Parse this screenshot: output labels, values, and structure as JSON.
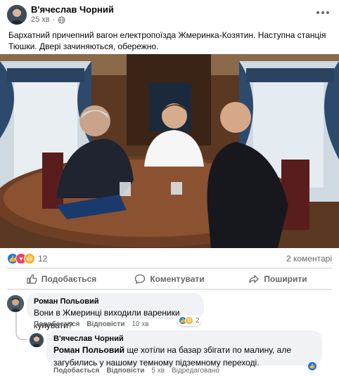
{
  "post": {
    "author": "В'ячеслав Чорний",
    "time": "25 хв",
    "text": "Бархатний причепний вагон електропоїзда Жмеринка-Козятин. Наступна станція Тюшки. Двері зачиняються, обережно."
  },
  "reactions": {
    "icons": [
      "like",
      "love",
      "haha"
    ],
    "count": "12",
    "comments_label": "2 коментарі"
  },
  "actions": {
    "like_label": "Подобається",
    "comment_label": "Коментувати",
    "share_label": "Поширити"
  },
  "comments": [
    {
      "author": "Роман Польовий",
      "text": "Вони в Жмеринці виходили вареники купувати?",
      "like_label": "Подобається",
      "reply_label": "Відповісти",
      "time": "10 хв",
      "reaction_count": "2"
    }
  ],
  "reply": {
    "author": "В'ячеслав Чорний",
    "mention": "Роман Польовий",
    "text": "ще хотіли на базар збігати по малину, але загубились у нашому темному підземному переході.",
    "like_label": "Подобається",
    "reply_label": "Відповісти",
    "time": "5 хв",
    "edited_label": "Відредаговано"
  },
  "colors": {
    "accent": "#1877f2",
    "meta_gray": "#65676b",
    "bubble_bg": "#f0f2f5"
  }
}
